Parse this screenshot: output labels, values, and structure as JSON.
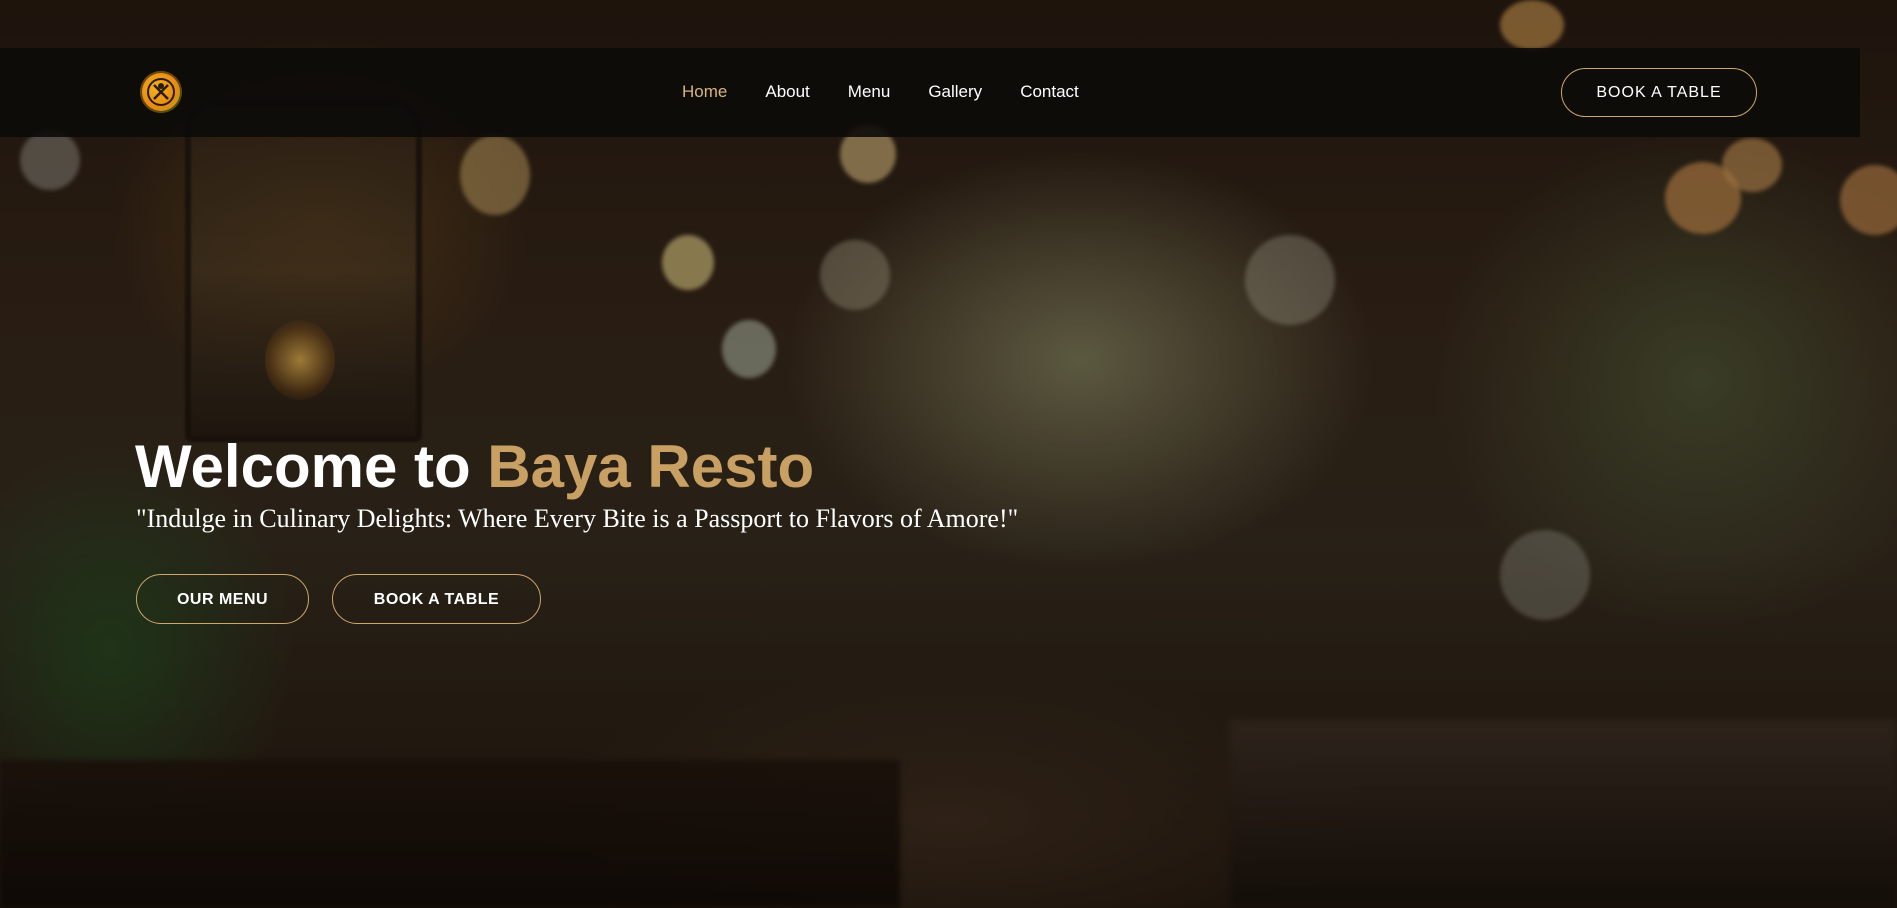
{
  "brand": {
    "logo_icon": "restaurant-logo-icon",
    "accent_color": "#c9a064"
  },
  "nav": {
    "items": [
      {
        "label": "Home",
        "active": true
      },
      {
        "label": "About",
        "active": false
      },
      {
        "label": "Menu",
        "active": false
      },
      {
        "label": "Gallery",
        "active": false
      },
      {
        "label": "Contact",
        "active": false
      }
    ],
    "cta_label": "BOOK A TABLE"
  },
  "hero": {
    "title_prefix": "Welcome to ",
    "title_accent": "Baya Resto",
    "tagline": "\"Indulge in Culinary Delights: Where Every Bite is a Passport to Flavors of Amore!\"",
    "buttons": {
      "menu_label": "OUR MENU",
      "book_label": "BOOK A TABLE"
    }
  }
}
